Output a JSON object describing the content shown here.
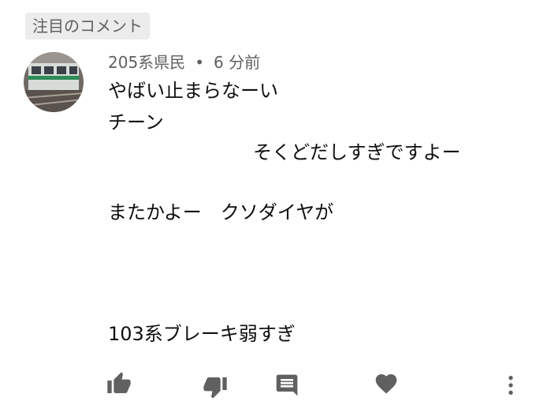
{
  "section_badge": "注目のコメント",
  "comment": {
    "author": "205系県民",
    "separator": "•",
    "time": "6 分前",
    "lines": [
      "やばい止まらなーい",
      "チーン",
      "そくどだしすぎですよー",
      "またかよー　クソダイヤが",
      "103系ブレーキ弱すぎ"
    ]
  },
  "avatar": {
    "subject": "green-striped train"
  },
  "actions": {
    "icons": [
      "thumbs-up-icon",
      "thumbs-down-icon",
      "reply-icon",
      "heart-icon",
      "more-vert-icon"
    ]
  },
  "colors": {
    "text_primary": "#0f0f0f",
    "text_secondary": "#606060",
    "badge_bg": "#ececec",
    "train_stripe": "#2e8b57"
  }
}
